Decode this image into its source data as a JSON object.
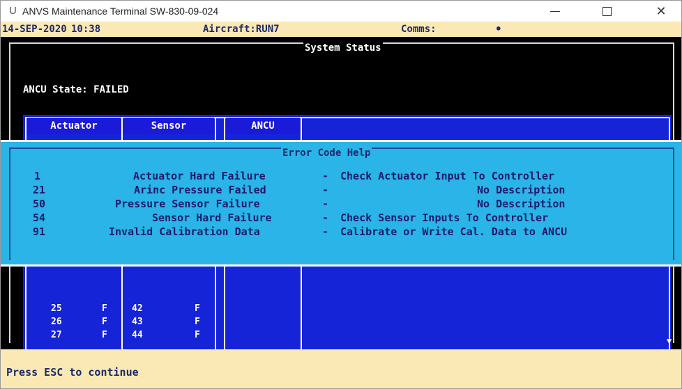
{
  "window": {
    "title": "ANVS Maintenance Terminal SW-830-09-024",
    "app_icon": "U",
    "controls": {
      "minimize_icon": "minimize-icon",
      "maximize_icon": "maximize-icon",
      "close_icon": "close-icon",
      "close_glyph": "✕"
    }
  },
  "header": {
    "date": "14-SEP-2020",
    "time": "10:38",
    "aircraft": "Aircraft:RUN7",
    "comms": "Comms:",
    "comms_dot": "•"
  },
  "system_status": {
    "title": "System Status",
    "ancu_state": "ANCU State: FAILED",
    "columns": [
      "Actuator",
      "Sensor",
      "ANCU"
    ],
    "rows": [
      {
        "actuator_id": "25",
        "actuator_flag": "F",
        "sensor_id": "42",
        "sensor_flag": "F"
      },
      {
        "actuator_id": "26",
        "actuator_flag": "F",
        "sensor_id": "43",
        "sensor_flag": "F"
      },
      {
        "actuator_id": "27",
        "actuator_flag": "F",
        "sensor_id": "44",
        "sensor_flag": "F"
      }
    ],
    "scroll_indicator": "▼"
  },
  "error_help": {
    "title": "Error Code Help",
    "entries": [
      {
        "code": "1",
        "name": "Actuator Hard Failure",
        "sep": "-",
        "desc": "Check Actuator Input To Controller"
      },
      {
        "code": "21",
        "name": "Arinc Pressure Failed",
        "sep": "-",
        "desc": "No Description"
      },
      {
        "code": "50",
        "name": "Pressure Sensor Failure",
        "sep": "-",
        "desc": "No Description"
      },
      {
        "code": "54",
        "name": "Sensor Hard Failure",
        "sep": "-",
        "desc": "Check Sensor Inputs To Controller"
      },
      {
        "code": "91",
        "name": "Invalid Calibration Data",
        "sep": "-",
        "desc": "Calibrate or Write Cal. Data to ANCU"
      }
    ]
  },
  "footer": {
    "prompt": "Press ESC to continue"
  },
  "colors": {
    "screen": "#000000",
    "table": "#1424d6",
    "help": "#2ab4e8",
    "panel": "#fbe9b5"
  }
}
